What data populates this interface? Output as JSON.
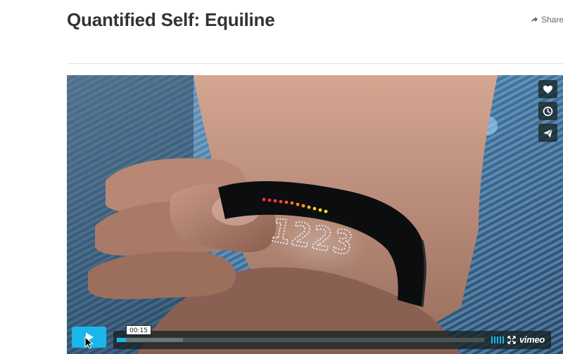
{
  "page": {
    "title": "Quantified Self: Equiline",
    "share_label": "Share"
  },
  "video": {
    "band_display": "1223",
    "sidebar_buttons": [
      {
        "name": "like",
        "icon": "heart-icon"
      },
      {
        "name": "watch-later",
        "icon": "clock-icon"
      },
      {
        "name": "share",
        "icon": "paper-plane-icon"
      }
    ],
    "controls": {
      "play_icon": "play-icon",
      "timecode": "00:15",
      "progress_played": 0.025,
      "progress_loaded": 0.18,
      "logo": "vimeo"
    }
  },
  "colors": {
    "accent": "#1ab7ea",
    "title_text": "#333333",
    "control_bg": "#172322"
  }
}
